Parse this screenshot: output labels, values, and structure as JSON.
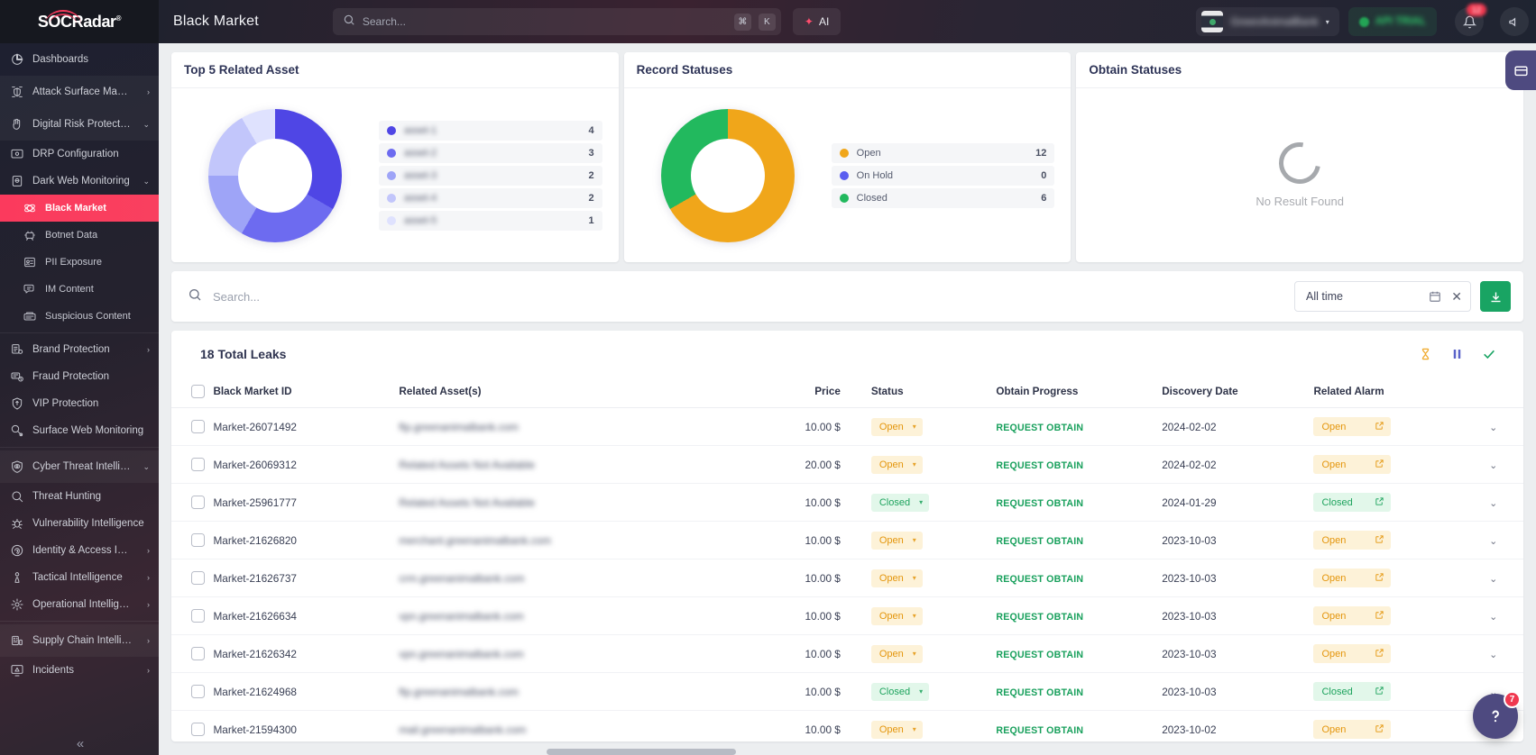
{
  "brand": {
    "name": "SOCRadar",
    "trademark": "®"
  },
  "sidebar": {
    "collapse_label": "«",
    "items": [
      {
        "label": "Dashboards",
        "icon": "dashboard-icon",
        "level": "group",
        "chevron": "",
        "state": ""
      },
      {
        "label": "Attack Surface Management",
        "icon": "shield-scan-icon",
        "level": "group",
        "chevron": "›",
        "state": "hl"
      },
      {
        "label": "Digital Risk Protection",
        "icon": "hand-alert-icon",
        "level": "group",
        "chevron": "⌄",
        "state": "hl"
      },
      {
        "label": "DRP Configuration",
        "icon": "monitor-config-icon",
        "level": "item",
        "chevron": "",
        "state": ""
      },
      {
        "label": "Dark Web Monitoring",
        "icon": "dark-web-icon",
        "level": "item",
        "chevron": "⌄",
        "state": ""
      },
      {
        "label": "Black Market",
        "icon": "black-market-icon",
        "level": "sub",
        "chevron": "",
        "state": "active"
      },
      {
        "label": "Botnet Data",
        "icon": "botnet-icon",
        "level": "sub",
        "chevron": "",
        "state": ""
      },
      {
        "label": "PII Exposure",
        "icon": "id-card-icon",
        "level": "sub",
        "chevron": "",
        "state": ""
      },
      {
        "label": "IM Content",
        "icon": "chat-content-icon",
        "level": "sub",
        "chevron": "",
        "state": ""
      },
      {
        "label": "Suspicious Content",
        "icon": "suspicious-content-icon",
        "level": "sub",
        "chevron": "",
        "state": ""
      },
      {
        "label": "Brand Protection",
        "icon": "brand-icon",
        "level": "item",
        "chevron": "›",
        "state": ""
      },
      {
        "label": "Fraud Protection",
        "icon": "fraud-icon",
        "level": "item",
        "chevron": "",
        "state": ""
      },
      {
        "label": "VIP Protection",
        "icon": "vip-icon",
        "level": "item",
        "chevron": "",
        "state": ""
      },
      {
        "label": "Surface Web Monitoring",
        "icon": "surface-web-icon",
        "level": "item",
        "chevron": "",
        "state": ""
      },
      {
        "label": "Cyber Threat Intelligence",
        "icon": "eye-shield-icon",
        "level": "group",
        "chevron": "⌄",
        "state": "hl"
      },
      {
        "label": "Threat Hunting",
        "icon": "magnifier-icon",
        "level": "item",
        "chevron": "",
        "state": ""
      },
      {
        "label": "Vulnerability Intelligence",
        "icon": "bug-icon",
        "level": "item",
        "chevron": "",
        "state": ""
      },
      {
        "label": "Identity & Access Intelligence",
        "icon": "fingerprint-icon",
        "level": "item",
        "chevron": "›",
        "state": ""
      },
      {
        "label": "Tactical Intelligence",
        "icon": "chess-pawn-icon",
        "level": "item",
        "chevron": "›",
        "state": ""
      },
      {
        "label": "Operational Intelligence",
        "icon": "gear-star-icon",
        "level": "item",
        "chevron": "›",
        "state": ""
      },
      {
        "label": "Supply Chain Intelligence",
        "icon": "supply-chain-icon",
        "level": "group",
        "chevron": "›",
        "state": "hl"
      },
      {
        "label": "Incidents",
        "icon": "incident-alert-icon",
        "level": "item",
        "chevron": "›",
        "state": ""
      }
    ]
  },
  "topbar": {
    "page_title": "Black Market",
    "search_placeholder": "Search...",
    "search_value": "",
    "kbd_cmd": "⌘",
    "kbd_key": "K",
    "ai_label": "AI",
    "org_name": "GreenAnimalBank",
    "org_chevron": "▾",
    "trial_label": "API TRIAL",
    "notification_count": "12"
  },
  "cards": {
    "top_related_asset": {
      "title": "Top 5 Related Asset"
    },
    "record_statuses": {
      "title": "Record Statuses"
    },
    "obtain_statuses": {
      "title": "Obtain Statuses",
      "empty_text": "No Result Found"
    }
  },
  "filterbar": {
    "search_placeholder": "Search...",
    "search_value": "",
    "daterange_label": "All time",
    "clear_label": "✕",
    "download_label": "download"
  },
  "table_panel": {
    "title": "18 Total Leaks",
    "actions": [
      {
        "name": "hourglass-icon",
        "color": "#f0a92b"
      },
      {
        "name": "pause-icon",
        "color": "#5a63c9"
      },
      {
        "name": "check-icon",
        "color": "#19a463"
      }
    ],
    "columns": [
      "Black Market ID",
      "Related Asset(s)",
      "Price",
      "Status",
      "Obtain Progress",
      "Discovery Date",
      "Related Alarm"
    ],
    "rows": [
      {
        "id": "Market-26071492",
        "asset": "ftp.greenanimalbank.com",
        "price": "10.00 $",
        "status": "Open",
        "obtain": "REQUEST OBTAIN",
        "date": "2024-02-02",
        "alarm": "Open"
      },
      {
        "id": "Market-26069312",
        "asset": "Related Assets Not Available",
        "price": "20.00 $",
        "status": "Open",
        "obtain": "REQUEST OBTAIN",
        "date": "2024-02-02",
        "alarm": "Open"
      },
      {
        "id": "Market-25961777",
        "asset": "Related Assets Not Available",
        "price": "10.00 $",
        "status": "Closed",
        "obtain": "REQUEST OBTAIN",
        "date": "2024-01-29",
        "alarm": "Closed"
      },
      {
        "id": "Market-21626820",
        "asset": "merchant.greenanimalbank.com",
        "price": "10.00 $",
        "status": "Open",
        "obtain": "REQUEST OBTAIN",
        "date": "2023-10-03",
        "alarm": "Open"
      },
      {
        "id": "Market-21626737",
        "asset": "crm.greenanimalbank.com",
        "price": "10.00 $",
        "status": "Open",
        "obtain": "REQUEST OBTAIN",
        "date": "2023-10-03",
        "alarm": "Open"
      },
      {
        "id": "Market-21626634",
        "asset": "vpn.greenanimalbank.com",
        "price": "10.00 $",
        "status": "Open",
        "obtain": "REQUEST OBTAIN",
        "date": "2023-10-03",
        "alarm": "Open"
      },
      {
        "id": "Market-21626342",
        "asset": "vpn.greenanimalbank.com",
        "price": "10.00 $",
        "status": "Open",
        "obtain": "REQUEST OBTAIN",
        "date": "2023-10-03",
        "alarm": "Open"
      },
      {
        "id": "Market-21624968",
        "asset": "ftp.greenanimalbank.com",
        "price": "10.00 $",
        "status": "Closed",
        "obtain": "REQUEST OBTAIN",
        "date": "2023-10-03",
        "alarm": "Closed"
      },
      {
        "id": "Market-21594300",
        "asset": "mail.greenanimalbank.com",
        "price": "10.00 $",
        "status": "Open",
        "obtain": "REQUEST OBTAIN",
        "date": "2023-10-02",
        "alarm": "Open"
      }
    ]
  },
  "chat": {
    "badge": "7"
  },
  "chart_data": [
    {
      "type": "pie",
      "title": "Top 5 Related Asset",
      "labels": [
        "asset-1",
        "asset-2",
        "asset-3",
        "asset-4",
        "asset-5"
      ],
      "labels_redacted": true,
      "values": [
        4,
        3,
        2,
        2,
        1
      ],
      "colors": [
        "#4f46e5",
        "#6d6bf0",
        "#9ea4f7",
        "#c2c6fb",
        "#dfe2fe"
      ],
      "legend": "right",
      "donut": true
    },
    {
      "type": "pie",
      "title": "Record Statuses",
      "labels": [
        "Open",
        "On Hold",
        "Closed"
      ],
      "values": [
        12,
        0,
        6
      ],
      "colors": [
        "#f0a61a",
        "#5a5ef0",
        "#22b95e"
      ],
      "legend": "right",
      "donut": true
    },
    {
      "type": "pie",
      "title": "Obtain Statuses",
      "labels": [],
      "values": [],
      "empty": true,
      "empty_text": "No Result Found"
    }
  ]
}
